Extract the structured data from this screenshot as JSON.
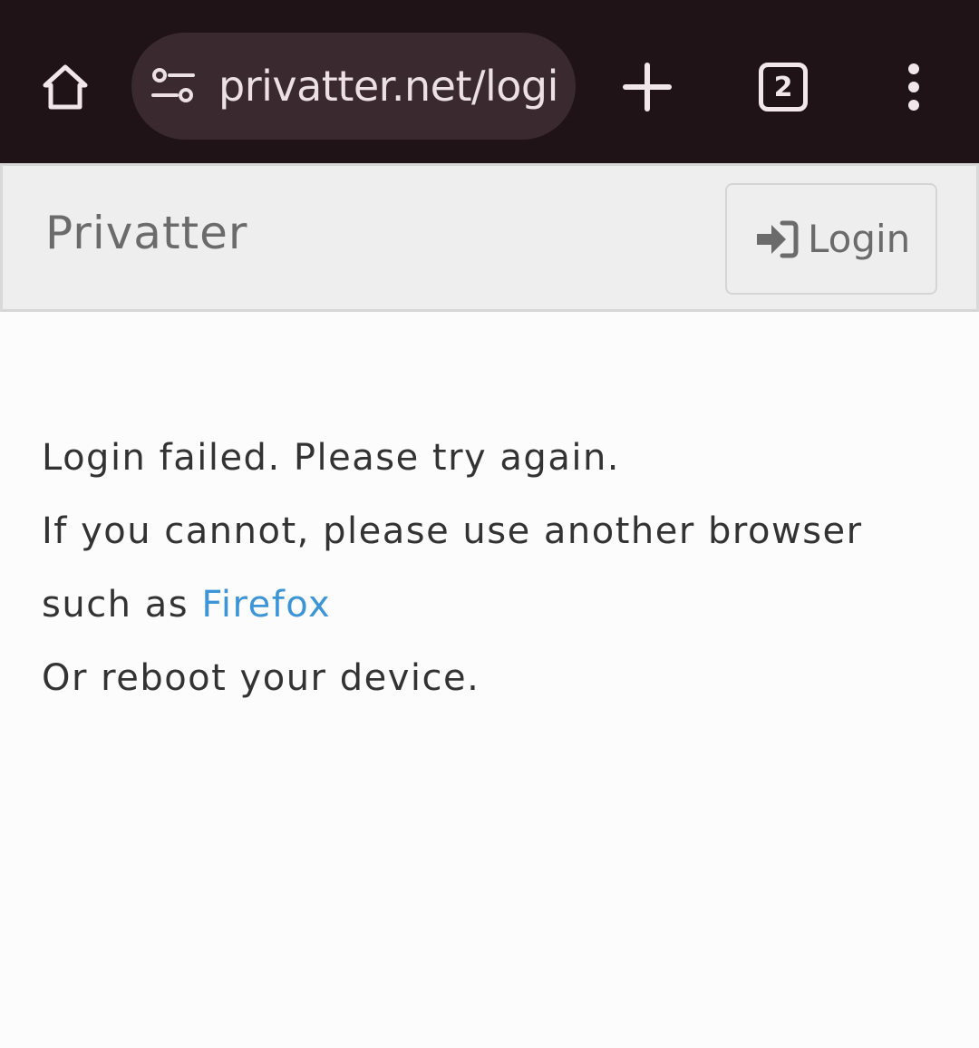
{
  "browser": {
    "url": "privatter.net/logi",
    "tab_count": "2",
    "icons": {
      "home": "home-icon",
      "site_info": "tune-icon",
      "new_tab": "plus-icon",
      "menu": "more-vert-icon"
    },
    "colors": {
      "toolbar_bg": "#1f1317",
      "url_pill_bg": "#3a2a30",
      "icon": "#f1e6ea"
    }
  },
  "site": {
    "brand": "Privatter",
    "login_label": "Login",
    "login_icon": "sign-in-icon"
  },
  "message": {
    "line1": "Login failed. Please try again.",
    "line2": "If you cannot, please use another browser",
    "line3_prefix": "such as ",
    "firefox_link": "Firefox",
    "line4": "Or reboot your device.",
    "link_color": "#3d95d6"
  }
}
